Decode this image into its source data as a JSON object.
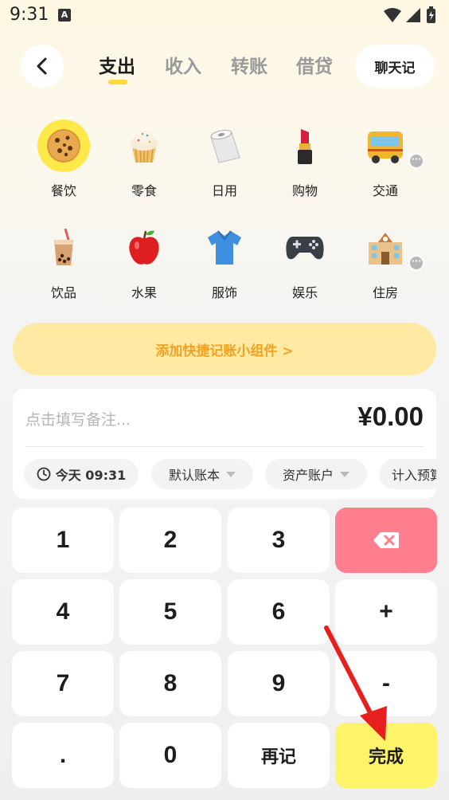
{
  "status": {
    "time": "9:31",
    "notif": "A"
  },
  "header": {
    "tabs": [
      {
        "label": "支出",
        "active": true
      },
      {
        "label": "收入",
        "active": false
      },
      {
        "label": "转账",
        "active": false
      },
      {
        "label": "借贷",
        "active": false
      }
    ],
    "chat_label": "聊天记"
  },
  "categories": [
    {
      "label": "餐饮",
      "icon": "cookie-icon",
      "emoji": "🍪",
      "selected": true
    },
    {
      "label": "零食",
      "icon": "cupcake-icon",
      "emoji": "🧁"
    },
    {
      "label": "日用",
      "icon": "toilet-paper-icon",
      "emoji": "🧻"
    },
    {
      "label": "购物",
      "icon": "lipstick-icon",
      "emoji": "💄"
    },
    {
      "label": "交通",
      "icon": "bus-icon",
      "emoji": "🚌",
      "more": true
    },
    {
      "label": "饮品",
      "icon": "bubble-tea-icon",
      "emoji": "🧋"
    },
    {
      "label": "水果",
      "icon": "apple-icon",
      "emoji": "🍎"
    },
    {
      "label": "服饰",
      "icon": "shirt-icon",
      "emoji": "👕"
    },
    {
      "label": "娱乐",
      "icon": "gamepad-icon",
      "emoji": "🎮"
    },
    {
      "label": "住房",
      "icon": "building-icon",
      "emoji": "🏫",
      "more": true
    }
  ],
  "banner": {
    "label": "添加快捷记账小组件 >"
  },
  "entry": {
    "note_placeholder": "点击填写备注...",
    "amount": "¥0.00",
    "chips": {
      "date": "今天 09:31",
      "book": "默认账本",
      "asset": "资产账户",
      "budget": "计入预算"
    }
  },
  "keypad": {
    "k1": "1",
    "k2": "2",
    "k3": "3",
    "k4": "4",
    "k5": "5",
    "k6": "6",
    "plus": "+",
    "k7": "7",
    "k8": "8",
    "k9": "9",
    "minus": "-",
    "dot": ".",
    "k0": "0",
    "again": "再记",
    "done": "完成"
  },
  "colors": {
    "accent_yellow": "#ffe84a",
    "delete_pink": "#ff7f8f",
    "done_yellow": "#fff36a",
    "banner_bg": "#ffe9a3",
    "banner_text": "#f0a220",
    "annotation_arrow": "#e8201d"
  }
}
